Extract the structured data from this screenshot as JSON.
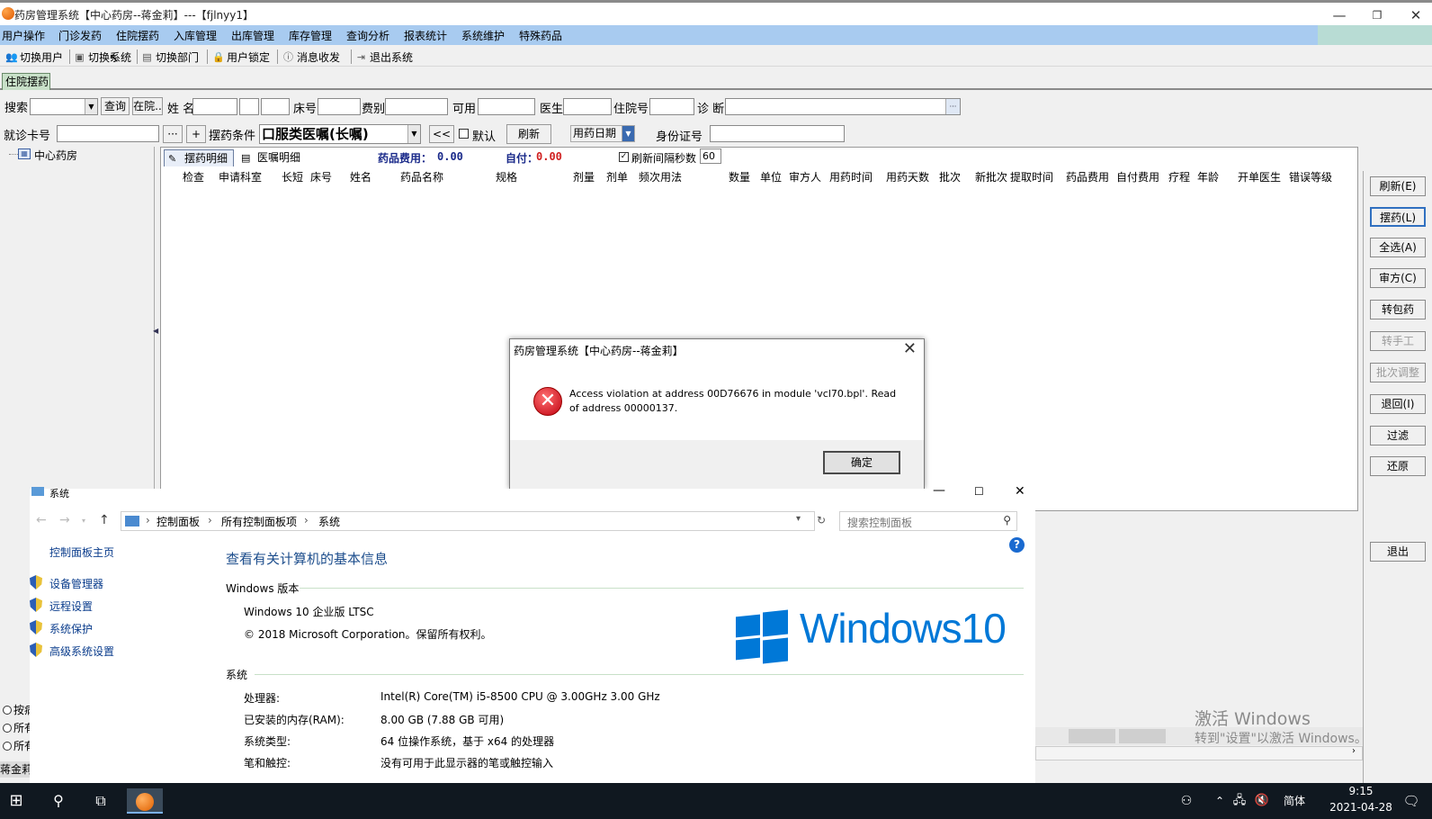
{
  "app": {
    "title": "药房管理系统【中心药房--蒋金莉】---【fjlnyy1】",
    "minimize": "—",
    "restore": "❐",
    "close": "✕"
  },
  "menu": [
    "用户操作",
    "门诊发药",
    "住院摆药",
    "入库管理",
    "出库管理",
    "库存管理",
    "查询分析",
    "报表统计",
    "系统维护",
    "特殊药品"
  ],
  "toolbar": [
    "切换用户",
    "切换系统",
    "切换部门",
    "用户锁定",
    "消息收发",
    "退出系统"
  ],
  "tab_main": "住院摆药",
  "search": {
    "search_label": "搜索",
    "query_btn": "查询",
    "inhosp_btn": "在院..",
    "name_label": "姓 名",
    "bed_label": "床号",
    "fee_label": "费别",
    "avail_label": "可用",
    "doctor_label": "医生",
    "inhosp_label": "住院号",
    "diag_label": "诊 断",
    "diag_btn": "···",
    "card_label": "就诊卡号",
    "card_more": "···",
    "card_plus": "+",
    "cond_label": "摆药条件",
    "cond_value": "口服类医嘱(长嘱)",
    "back_btn": "<<",
    "default_label": "默认",
    "refresh_btn": "刷新",
    "date_value": "用药日期",
    "id_label": "身份证号"
  },
  "tree": {
    "root": "中心药房"
  },
  "grid": {
    "tab1": "摆药明细",
    "tab2": "医嘱明细",
    "cost_label": "药品费用：",
    "cost_value": "0.00",
    "self_label": "自付：",
    "self_value": "0.00",
    "interval_label": "刷新间隔秒数",
    "interval_value": "60",
    "headers": [
      "检查",
      "申请科室",
      "长短",
      "床号",
      "姓名",
      "药品名称",
      "规格",
      "剂量",
      "剂单",
      "频次用法",
      "数量",
      "单位",
      "审方人",
      "用药时间",
      "用药天数",
      "批次",
      "新批次",
      "提取时间",
      "药品费用",
      "自付费用",
      "疗程",
      "年龄",
      "开单医生",
      "错误等级"
    ]
  },
  "right_buttons": [
    "刷新(E)",
    "摆药(L)",
    "全选(A)",
    "审方(C)",
    "转包药",
    "转手工",
    "批次调整",
    "退回(I)",
    "过滤",
    "还原",
    "退出"
  ],
  "dialog": {
    "title": "药房管理系统【中心药房--蒋金莉】",
    "message": "Access violation at address 00D76676 in module 'vcl70.bpl'. Read of address 00000137.",
    "ok": "确定",
    "close": "✕"
  },
  "syswin": {
    "title": "系统",
    "breadcrumb": [
      "控制面板",
      "所有控制面板项",
      "系统"
    ],
    "search_placeholder": "搜索控制面板",
    "left_home": "控制面板主页",
    "left_links": [
      "设备管理器",
      "远程设置",
      "系统保护",
      "高级系统设置"
    ],
    "heading": "查看有关计算机的基本信息",
    "edition_section": "Windows 版本",
    "edition": "Windows 10 企业版 LTSC",
    "copyright": "© 2018 Microsoft Corporation。保留所有权利。",
    "logo_text": "Windows10",
    "system_section": "系统",
    "rows": [
      {
        "k": "处理器:",
        "v": "Intel(R) Core(TM) i5-8500 CPU @ 3.00GHz   3.00 GHz"
      },
      {
        "k": "已安装的内存(RAM):",
        "v": "8.00 GB (7.88 GB 可用)"
      },
      {
        "k": "系统类型:",
        "v": "64 位操作系统，基于 x64 的处理器"
      },
      {
        "k": "笔和触控:",
        "v": "没有可用于此显示器的笔或触控输入"
      }
    ]
  },
  "activate": {
    "line1": "激活 Windows",
    "line2": "转到\"设置\"以激活 Windows。"
  },
  "bottom_left": {
    "radios": [
      "按病",
      "所有",
      "所有"
    ],
    "status": "蒋金莉"
  },
  "taskbar": {
    "ime": "简体",
    "time": "9:15",
    "date": "2021-04-28"
  }
}
